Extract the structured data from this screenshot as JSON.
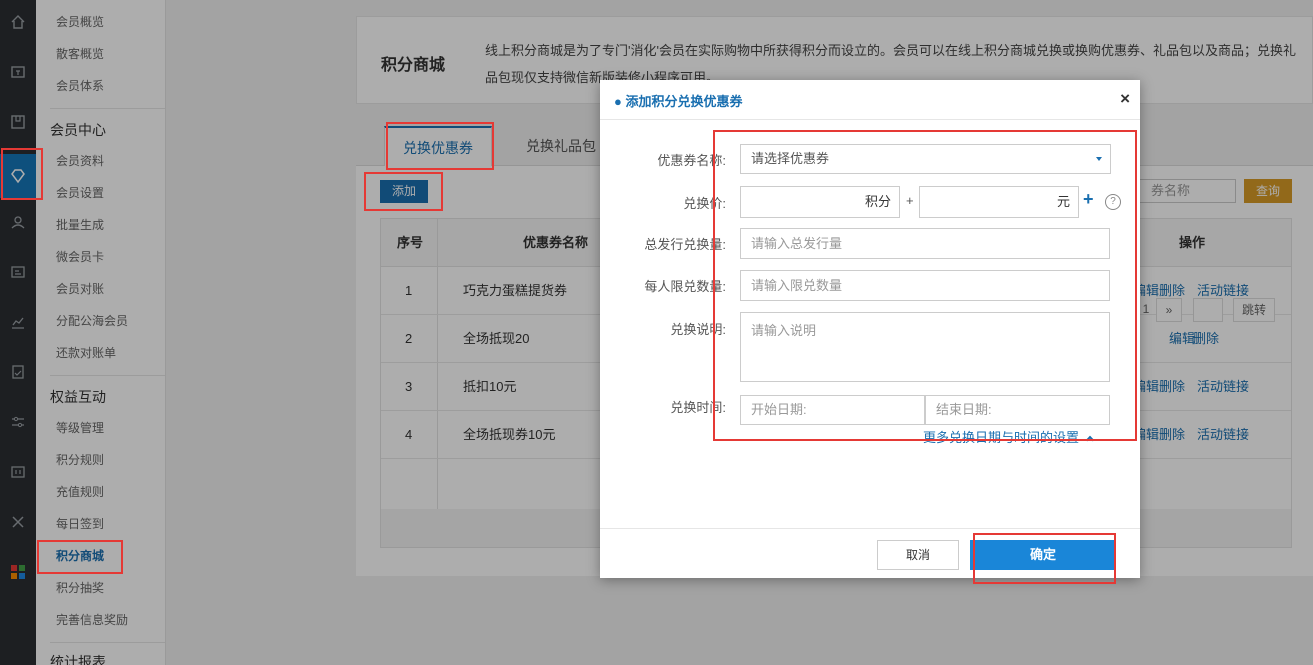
{
  "sidebar_rail": {
    "icons": [
      "home-icon",
      "wallet-icon",
      "box-icon",
      "diamond-icon",
      "people-icon",
      "id-card-icon",
      "chart-icon",
      "clipboard-icon",
      "sliders-icon",
      "card-icon",
      "tools-icon",
      "apps-grid-icon"
    ],
    "active_icon": "diamond-icon",
    "colors": [
      "#e53935",
      "#43a047",
      "#fb8c00",
      "#1e88e5"
    ]
  },
  "submenu": {
    "items_top": [
      "会员概览",
      "散客概览",
      "会员体系"
    ],
    "section_member": "会员中心",
    "items_member": [
      "会员资料",
      "会员设置",
      "批量生成",
      "微会员卡",
      "会员对账",
      "分配公海会员",
      "还款对账单"
    ],
    "section_rights": "权益互动",
    "items_rights": [
      "等级管理",
      "积分规则",
      "充值规则",
      "每日签到",
      "积分商城",
      "积分抽奖",
      "完善信息奖励"
    ],
    "section_stats": "统计报表",
    "active": "积分商城"
  },
  "page": {
    "title": "积分商城",
    "description": "线上积分商城是为了专门'消化'会员在实际购物中所获得积分而设立的。会员可以在线上积分商城兑换或换购优惠券、礼品包以及商品；兑换礼品包现仅支持微信新版装修小程序可用。",
    "tabs": [
      "兑换优惠券",
      "兑换礼品包"
    ],
    "add_label": "添加",
    "search_placeholder": "券名称",
    "search_label": "查询"
  },
  "table": {
    "headers": {
      "index": "序号",
      "name": "优惠券名称",
      "ops": "操作"
    },
    "rows": [
      {
        "index": "1",
        "name": "巧克力蛋糕提货券",
        "ops": [
          "编辑",
          "删除",
          "活动链接"
        ]
      },
      {
        "index": "2",
        "name": "全场抵现20",
        "ops": [
          "编辑",
          "删除"
        ]
      },
      {
        "index": "3",
        "name": "抵扣10元",
        "ops": [
          "编辑",
          "删除",
          "活动链接"
        ]
      },
      {
        "index": "4",
        "name": "全场抵现券10元",
        "ops": [
          "编辑",
          "删除",
          "活动链接"
        ]
      }
    ],
    "pagination": {
      "page": "1",
      "next": "»",
      "jump_label": "跳转"
    }
  },
  "dialog": {
    "title": "● 添加积分兑换优惠券",
    "close": "×",
    "fields": {
      "coupon_name_label": "优惠券名称:",
      "coupon_name_placeholder": "请选择优惠券",
      "price_label": "兑换价:",
      "points_unit": "积分",
      "plus_sign": "+",
      "yuan_unit": "元",
      "total_label": "总发行兑换量:",
      "total_placeholder": "请输入总发行量",
      "limit_label": "每人限兑数量:",
      "limit_placeholder": "请输入限兑数量",
      "desc_label": "兑换说明:",
      "desc_placeholder": "请输入说明",
      "time_label": "兑换时间:",
      "start_placeholder": "开始日期:",
      "end_placeholder": "结束日期:",
      "more_link": "更多兑换日期与时间的设置"
    },
    "cancel_label": "取消",
    "ok_label": "确定"
  }
}
